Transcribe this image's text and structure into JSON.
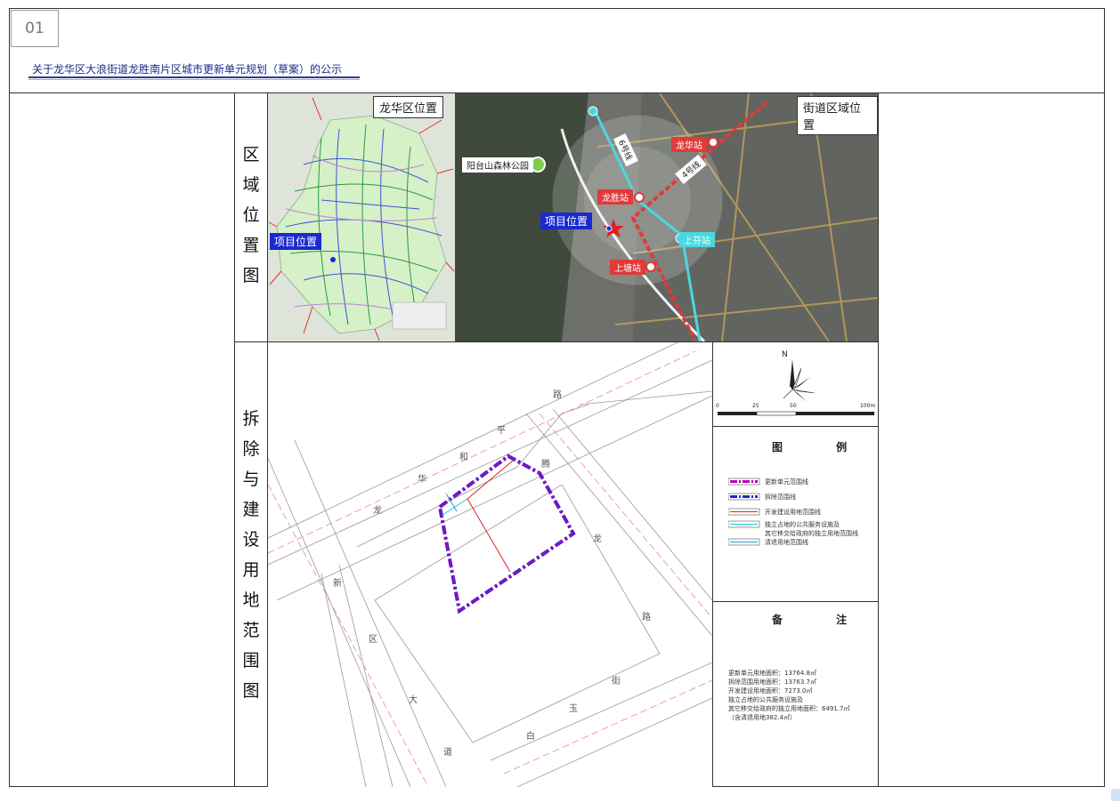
{
  "page": {
    "number": "01",
    "title": "关于龙华区大浪街道龙胜南片区城市更新单元规划（草案）的公示"
  },
  "section1": {
    "label_chars": [
      "区",
      "域",
      "位",
      "置",
      "图"
    ],
    "left_map": {
      "title": "龙华区位置",
      "project_tag": "项目位置"
    },
    "right_map": {
      "title": "街道区域位置",
      "park": "阳台山森林公园",
      "project_tag": "项目位置",
      "stations": [
        "龙华站",
        "龙胜站",
        "上塘站",
        "上芬站"
      ],
      "lines": [
        "6号线",
        "4号线"
      ]
    }
  },
  "section2": {
    "label_chars": [
      "拆",
      "除",
      "与",
      "建",
      "设",
      "用",
      "地",
      "范",
      "围",
      "图"
    ],
    "north": "N",
    "scale": [
      "0",
      "25",
      "50",
      "100m"
    ],
    "legend": {
      "title": "图 例",
      "items": [
        {
          "label": "更新单元范围线",
          "color": "#b000c0"
        },
        {
          "label": "拆除范围线",
          "color": "#1a2ad0"
        },
        {
          "label": "开发建设用地范围线",
          "color": "#e02020"
        },
        {
          "label": "独立占地的公共服务设施及",
          "color": "#19c8d8"
        },
        {
          "label": "其它移交给政府的独立用地范围线",
          "color": ""
        },
        {
          "label": "清退用地范围线",
          "color": "#2a9ad8"
        }
      ]
    },
    "remarks": {
      "title": "备 注",
      "lines": [
        "更新单元用地面积：13764.8㎡",
        "拆除范围用地面积：13763.7㎡",
        "开发建设用地面积：7273.0㎡",
        "独立占地的公共服务设施及",
        "其它移交给政府的独立用地面积：6491.7㎡",
        "（含清退用地382.4㎡）"
      ]
    },
    "road_chars": {
      "top": [
        "龙",
        "华",
        "和",
        "平",
        "路"
      ],
      "right1": [
        "腾",
        "龙",
        "路"
      ],
      "left": [
        "新",
        "区",
        "大",
        "道"
      ],
      "bottom": [
        "白",
        "玉",
        "街"
      ]
    }
  }
}
